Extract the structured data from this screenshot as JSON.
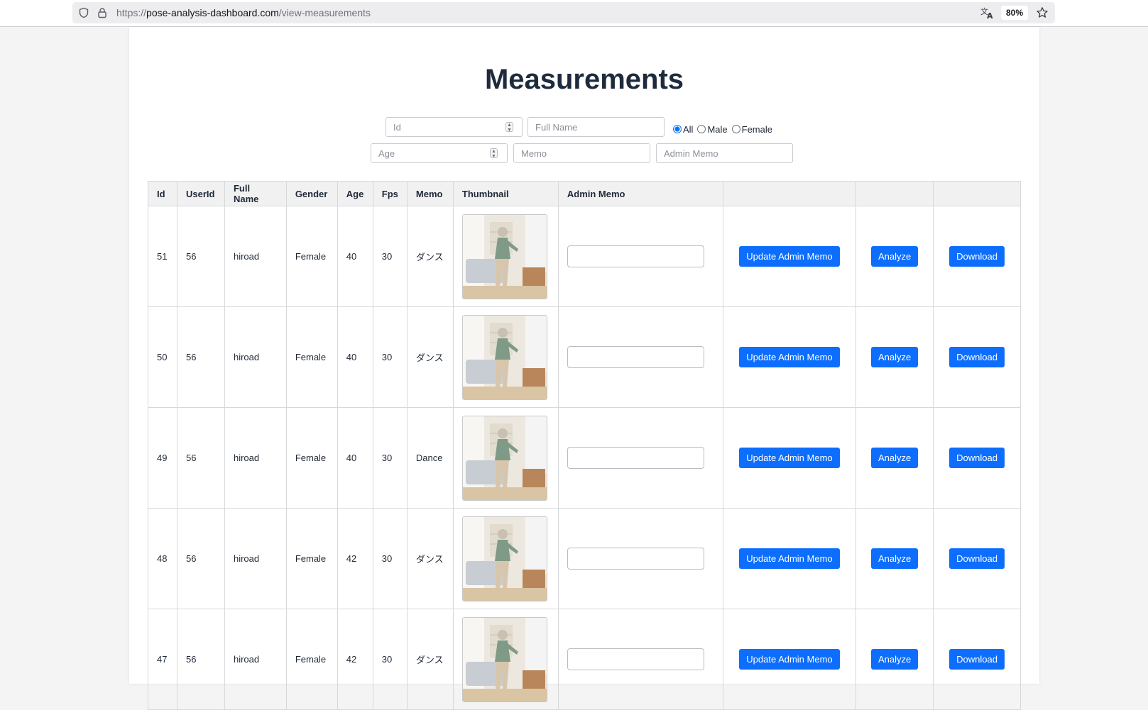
{
  "browser": {
    "url_scheme": "https://",
    "url_host": "pose-analysis-dashboard.com",
    "url_path": "/view-measurements",
    "zoom": "80%"
  },
  "page": {
    "title": "Measurements"
  },
  "filters": {
    "id_placeholder": "Id",
    "full_name_placeholder": "Full Name",
    "age_placeholder": "Age",
    "memo_placeholder": "Memo",
    "admin_memo_placeholder": "Admin Memo",
    "gender_options": [
      "All",
      "Male",
      "Female"
    ],
    "gender_selected": "All"
  },
  "table": {
    "headers": [
      "Id",
      "UserId",
      "Full Name",
      "Gender",
      "Age",
      "Fps",
      "Memo",
      "Thumbnail",
      "Admin Memo",
      "",
      "",
      ""
    ],
    "buttons": {
      "update": "Update Admin Memo",
      "analyze": "Analyze",
      "download": "Download"
    },
    "rows": [
      {
        "id": "51",
        "userId": "56",
        "fullName": "hiroad",
        "gender": "Female",
        "age": "40",
        "fps": "30",
        "memo": "ダンス",
        "adminMemo": ""
      },
      {
        "id": "50",
        "userId": "56",
        "fullName": "hiroad",
        "gender": "Female",
        "age": "40",
        "fps": "30",
        "memo": "ダンス",
        "adminMemo": ""
      },
      {
        "id": "49",
        "userId": "56",
        "fullName": "hiroad",
        "gender": "Female",
        "age": "40",
        "fps": "30",
        "memo": "Dance",
        "adminMemo": ""
      },
      {
        "id": "48",
        "userId": "56",
        "fullName": "hiroad",
        "gender": "Female",
        "age": "42",
        "fps": "30",
        "memo": "ダンス",
        "adminMemo": ""
      },
      {
        "id": "47",
        "userId": "56",
        "fullName": "hiroad",
        "gender": "Female",
        "age": "42",
        "fps": "30",
        "memo": "ダンス",
        "adminMemo": ""
      }
    ]
  },
  "colors": {
    "primary": "#0d6efd",
    "title": "#1e2b3c"
  }
}
